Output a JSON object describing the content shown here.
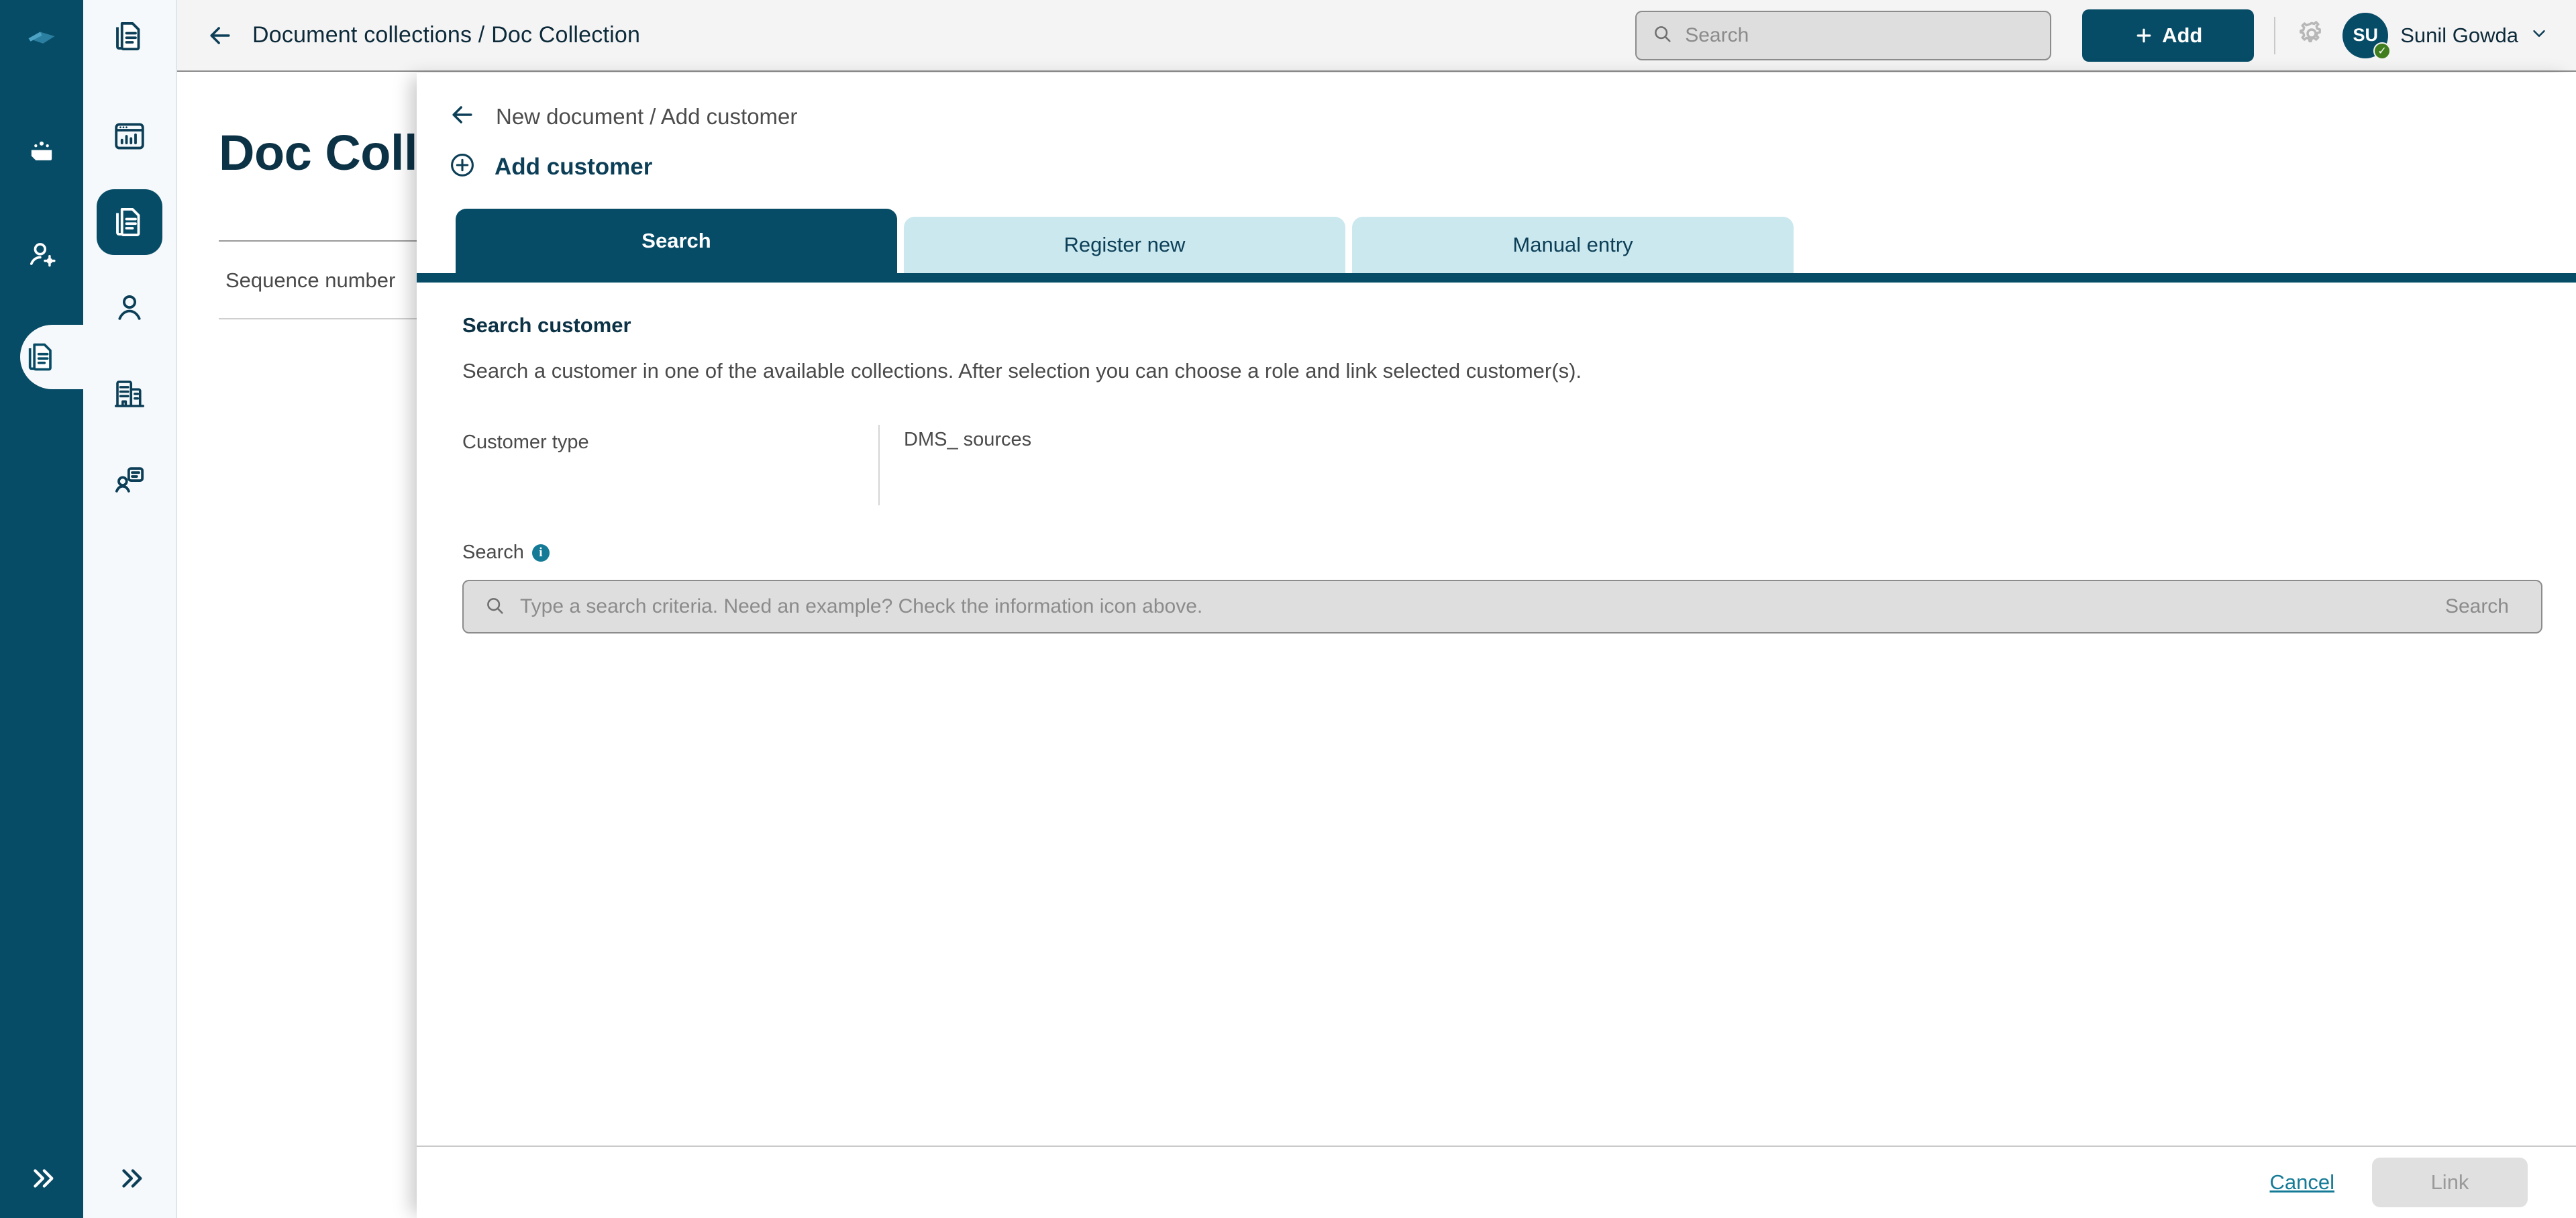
{
  "rail": {
    "logo_icon": "app-logo-icon",
    "items": [
      {
        "icon": "folder-group-icon",
        "name": "collections",
        "active": false
      },
      {
        "icon": "user-settings-icon",
        "name": "user-admin",
        "active": false
      },
      {
        "icon": "documents-icon",
        "name": "documents",
        "active": true
      }
    ],
    "expand_label": "»"
  },
  "sidebar": {
    "top_icon": "documents-icon",
    "items": [
      {
        "icon": "dashboard-icon",
        "name": "dashboard",
        "active": false
      },
      {
        "icon": "documents-icon",
        "name": "document-collections",
        "active": true
      },
      {
        "icon": "person-icon",
        "name": "persons",
        "active": false
      },
      {
        "icon": "building-icon",
        "name": "organizations",
        "active": false
      },
      {
        "icon": "contact-card-icon",
        "name": "contacts",
        "active": false
      }
    ],
    "expand_label": "»"
  },
  "topbar": {
    "breadcrumb": "Document collections / Doc Collection",
    "search_placeholder": "Search",
    "add_label": "Add",
    "settings_icon": "gear-icon",
    "avatar_initials": "SU",
    "user_name": "Sunil Gowda",
    "status_badge": "✓"
  },
  "page": {
    "title": "Doc Colle",
    "column_header": "Sequence number"
  },
  "modal": {
    "breadcrumb": "New document / Add customer",
    "title": "Add customer",
    "tabs": [
      {
        "label": "Search",
        "active": true
      },
      {
        "label": "Register new",
        "active": false
      },
      {
        "label": "Manual entry",
        "active": false
      }
    ],
    "section_title": "Search customer",
    "section_desc": "Search a customer in one of the available collections. After selection you can choose a role and link selected customer(s).",
    "customer_type_label": "Customer type",
    "customer_type_value": "DMS_ sources",
    "search_label": "Search",
    "info_icon_char": "i",
    "search_placeholder": "Type a search criteria. Need an example? Check the information icon above.",
    "search_button_label": "Search",
    "cancel_label": "Cancel",
    "link_label": "Link"
  },
  "colors": {
    "brand_dark": "#074c66",
    "tab_idle": "#cbe8ef",
    "accent_link": "#147a96",
    "status_green": "#3f7d1e"
  }
}
